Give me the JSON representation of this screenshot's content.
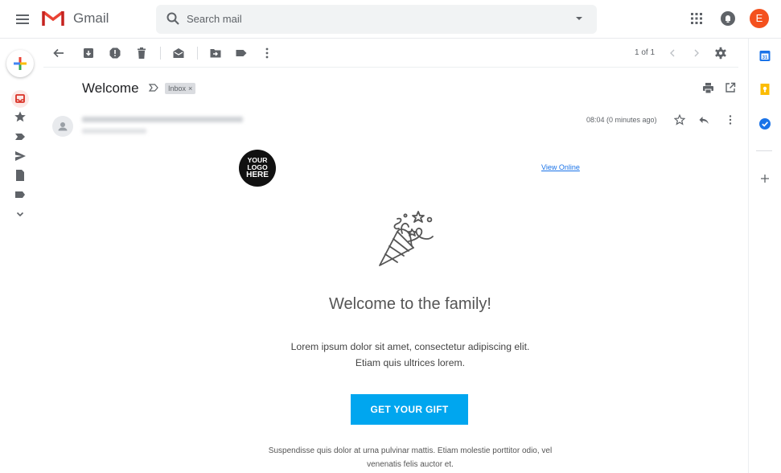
{
  "app": {
    "name": "Gmail"
  },
  "search": {
    "placeholder": "Search mail"
  },
  "user": {
    "avatar_initial": "E",
    "avatar_color": "#f4511e"
  },
  "toolbar": {
    "page_count": "1 of 1"
  },
  "message": {
    "subject": "Welcome",
    "label_chip": "Inbox",
    "label_chip_remove": "×",
    "timestamp": "08:04 (0 minutes ago)"
  },
  "email_body": {
    "logo_lines": [
      "YOUR",
      "LOGO",
      "HERE"
    ],
    "view_online": "View Online",
    "headline": "Welcome to the family!",
    "paragraph_line1": "Lorem ipsum dolor sit amet, consectetur adipiscing elit.",
    "paragraph_line2": "Etiam quis ultrices lorem.",
    "cta_label": "GET YOUR GIFT",
    "cta_color": "#00a6ef",
    "footer_line1": "Suspendisse quis dolor at urna pulvinar mattis. Etiam molestie porttitor odio, vel",
    "footer_line2": "venenatis felis auctor et."
  },
  "left_rail": {
    "icons": [
      "compose-icon",
      "inbox-icon",
      "star-icon",
      "important-icon",
      "send-icon",
      "file-icon",
      "label-icon",
      "expand-more-icon"
    ]
  },
  "side_panel": {
    "icons": [
      "calendar-icon",
      "keep-icon",
      "tasks-icon",
      "add-icon"
    ]
  }
}
